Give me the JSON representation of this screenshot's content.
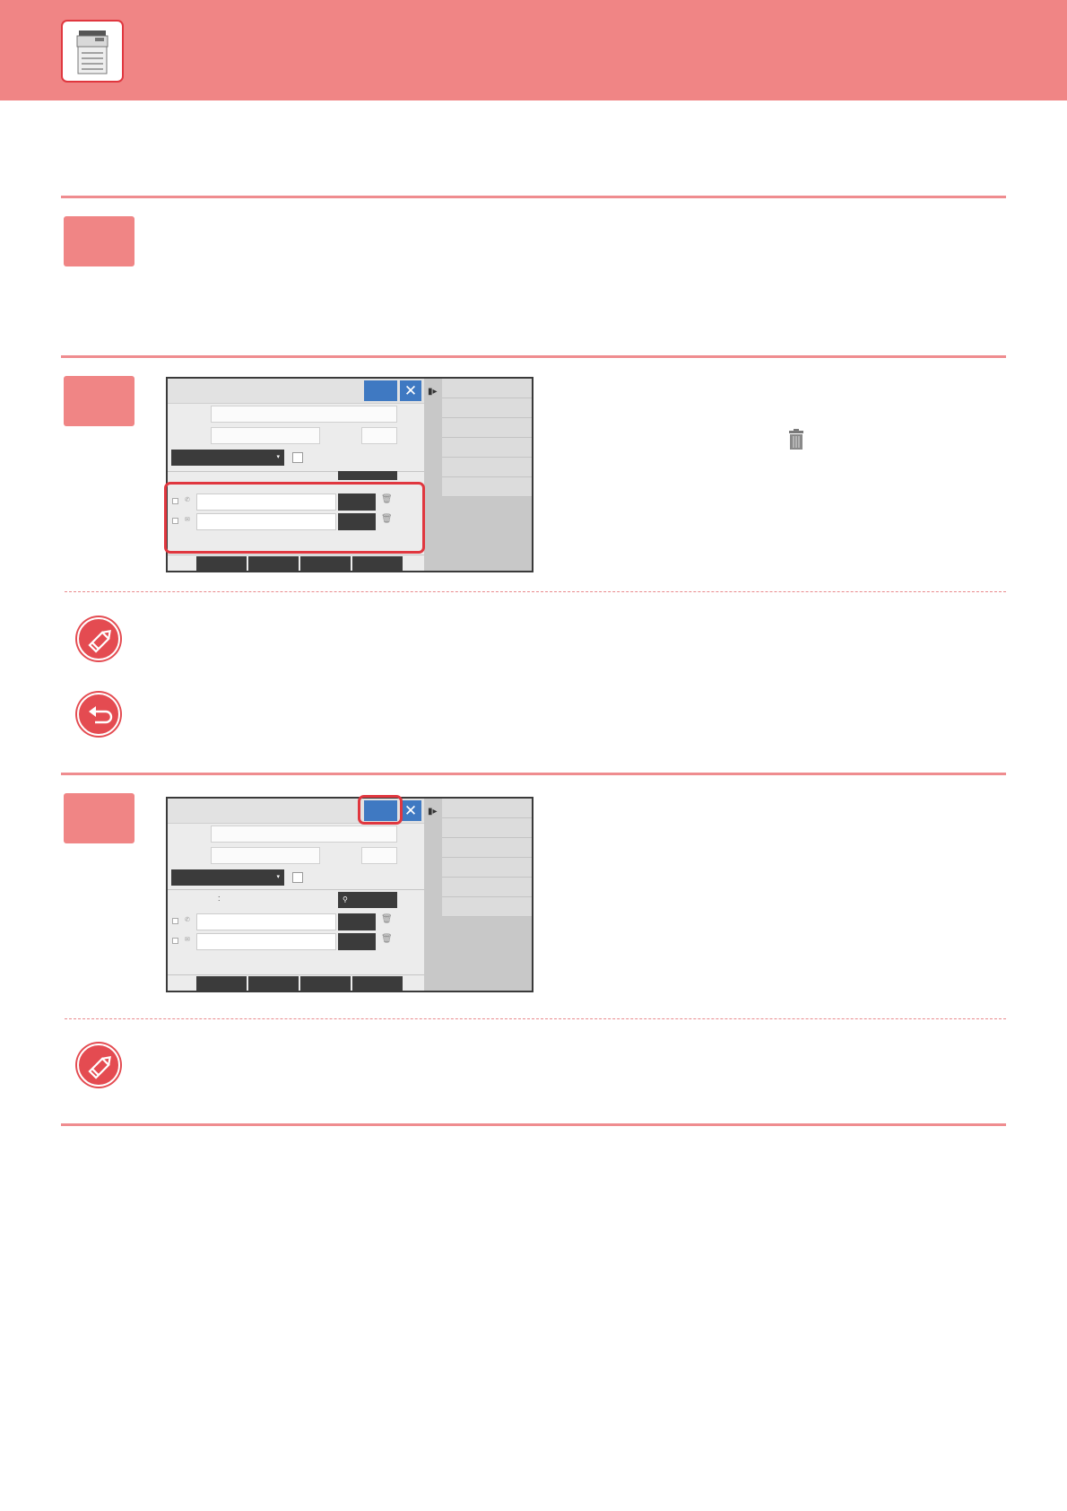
{
  "header": {
    "icon": "multifunction-printer-icon"
  },
  "steps": [
    {
      "badge_label": ""
    },
    {
      "badge_label": ""
    },
    {
      "badge_label": ""
    }
  ],
  "notes": [
    {
      "icon": "pencil-note-icon"
    },
    {
      "icon": "return-arrow-icon"
    },
    {
      "icon": "pencil-note-icon"
    }
  ],
  "inline_icon": "trash-icon",
  "screen": {
    "close_glyph": "✕",
    "expand_glyph": "▮▸",
    "dropdown_glyph": "▾",
    "colon": ":",
    "trash_glyph": "🗑"
  },
  "colors": {
    "accent": "#f08585",
    "highlight": "#e0373f",
    "button_blue": "#3f79c2"
  }
}
